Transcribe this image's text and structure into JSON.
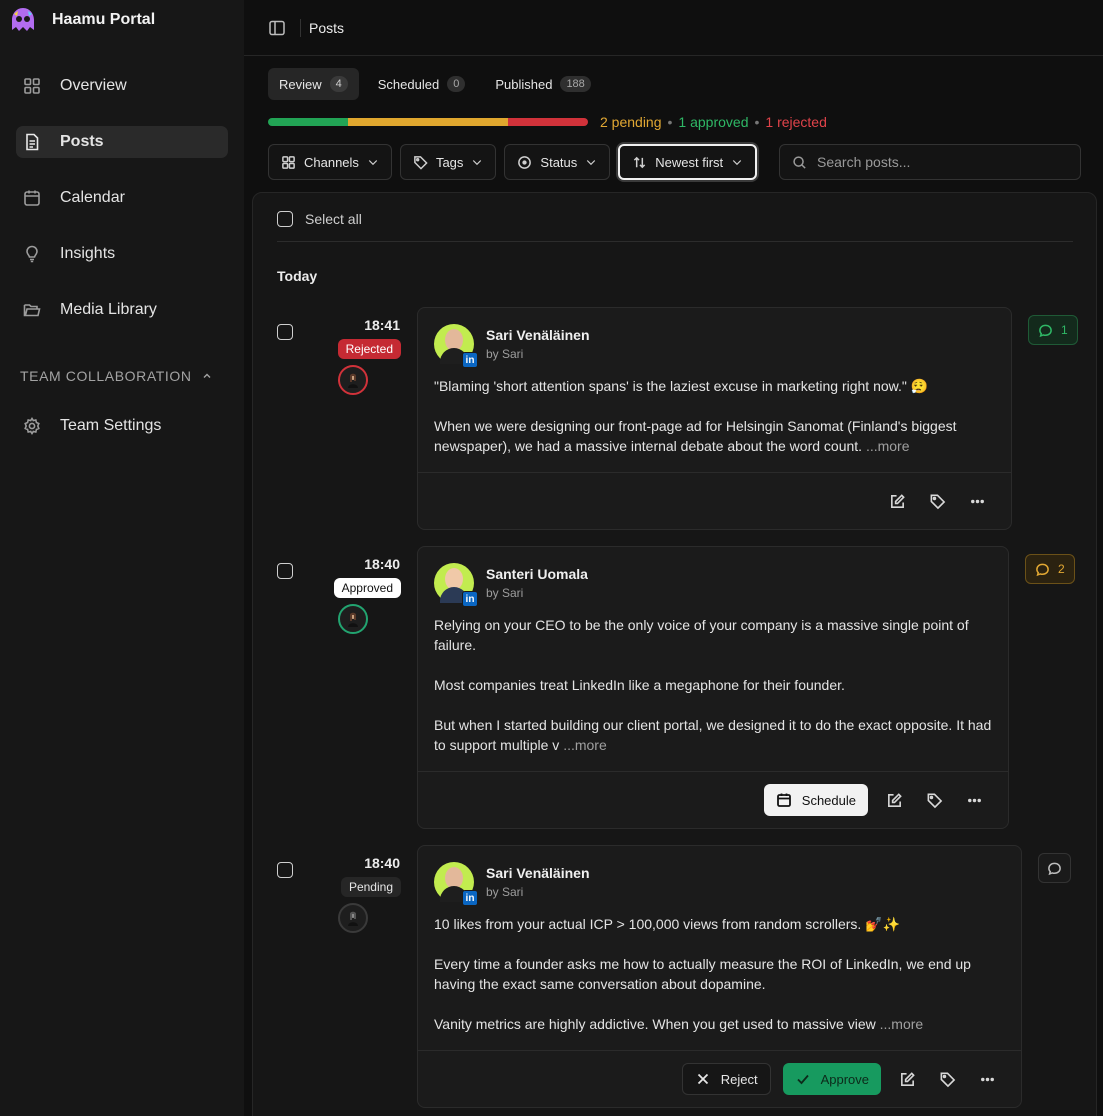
{
  "app": {
    "name": "Haamu Portal"
  },
  "sidebar": {
    "items": [
      {
        "label": "Overview",
        "icon": "grid-icon"
      },
      {
        "label": "Posts",
        "icon": "document-icon"
      },
      {
        "label": "Calendar",
        "icon": "calendar-icon"
      },
      {
        "label": "Insights",
        "icon": "lightbulb-icon"
      },
      {
        "label": "Media Library",
        "icon": "folder-icon"
      }
    ],
    "section": {
      "label": "TEAM COLLABORATION"
    },
    "section_items": [
      {
        "label": "Team Settings",
        "icon": "gear-icon"
      }
    ]
  },
  "header": {
    "title": "Posts"
  },
  "tabs": [
    {
      "label": "Review",
      "count": "4"
    },
    {
      "label": "Scheduled",
      "count": "0"
    },
    {
      "label": "Published",
      "count": "188"
    }
  ],
  "progress": {
    "approved_fraction": 0.25,
    "pending_fraction": 0.5,
    "rejected_fraction": 0.25,
    "pending_text": "2 pending",
    "approved_text": "1 approved",
    "rejected_text": "1 rejected",
    "separator": "•",
    "colors": {
      "approved": "#22a455",
      "pending": "#e0a72e",
      "rejected": "#d1323a"
    }
  },
  "filters": {
    "channels": "Channels",
    "tags": "Tags",
    "status": "Status",
    "sort": "Newest first",
    "search_placeholder": "Search posts..."
  },
  "list": {
    "select_all": "Select all",
    "group": "Today",
    "posts": [
      {
        "time": "18:41",
        "status": "Rejected",
        "author": "Sari Venäläinen",
        "by": "by Sari",
        "paragraphs": [
          "\"Blaming 'short attention spans' is the laziest excuse in marketing right now.\" 😮‍💨",
          "When we were designing our front-page ad for Helsingin Sanomat (Finland's biggest newspaper), we had a massive internal debate about the word count."
        ],
        "more": "...more",
        "comments": "1"
      },
      {
        "time": "18:40",
        "status": "Approved",
        "author": "Santeri Uomala",
        "by": "by Sari",
        "paragraphs": [
          "Relying on your CEO to be the only voice of your company is a massive single point of failure.",
          "Most companies treat LinkedIn like a megaphone for their founder.",
          "But when I started building our client portal, we designed it to do the exact opposite. It had to support multiple v"
        ],
        "more": "...more",
        "schedule_label": "Schedule",
        "comments": "2"
      },
      {
        "time": "18:40",
        "status": "Pending",
        "author": "Sari Venäläinen",
        "by": "by Sari",
        "paragraphs": [
          "10 likes from your actual ICP > 100,000 views from random scrollers. 💅✨",
          "Every time a founder asks me how to actually measure the ROI of LinkedIn, we end up having the exact same conversation about dopamine.",
          "Vanity metrics are highly addictive. When you get used to massive view"
        ],
        "more": "...more",
        "reject_label": "Reject",
        "approve_label": "Approve"
      }
    ]
  },
  "linkedin_badge": "in"
}
